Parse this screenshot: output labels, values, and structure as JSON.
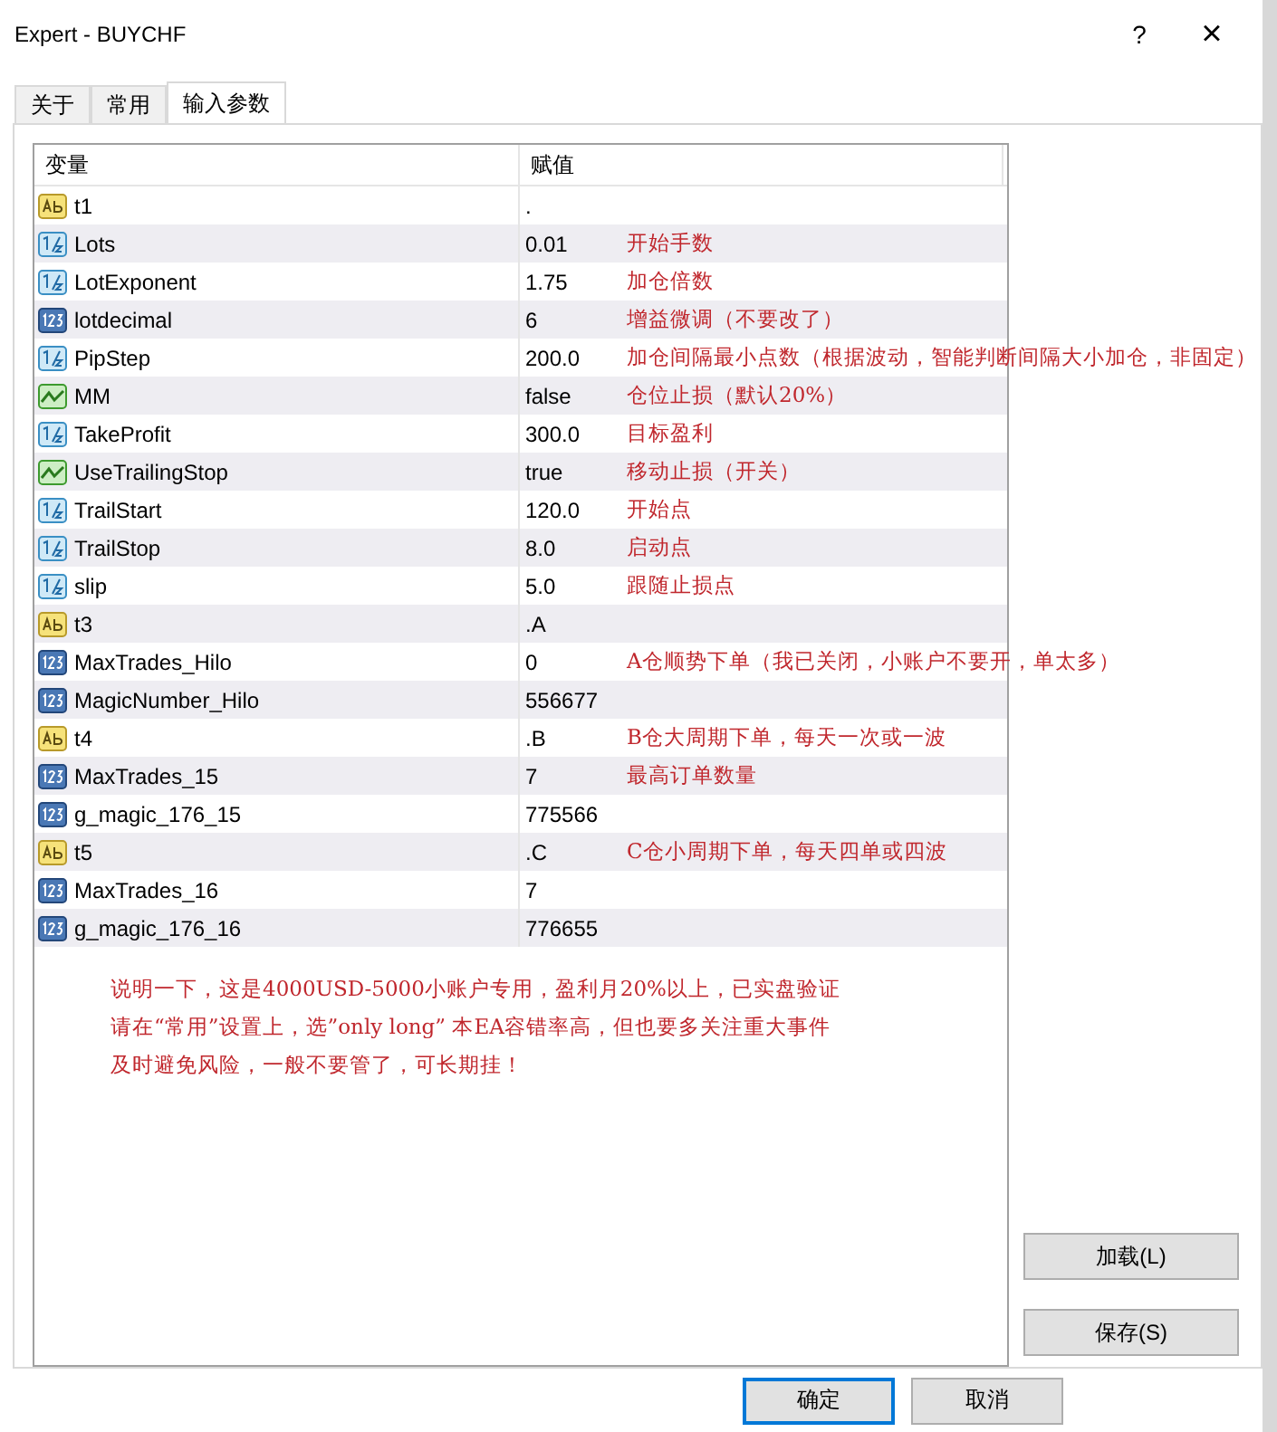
{
  "window": {
    "title": "Expert - BUYCHF",
    "help": "?",
    "close": "×"
  },
  "tabs": [
    {
      "label": "关于",
      "selected": false
    },
    {
      "label": "常用",
      "selected": false
    },
    {
      "label": "输入参数",
      "selected": true
    }
  ],
  "table": {
    "columns": [
      "变量",
      "赋值"
    ],
    "rows": [
      {
        "kind": "string",
        "name": "t1",
        "value": "."
      },
      {
        "kind": "double",
        "name": "Lots",
        "value": "0.01",
        "note": "开始手数"
      },
      {
        "kind": "double",
        "name": "LotExponent",
        "value": "1.75",
        "note": "加仓倍数"
      },
      {
        "kind": "int",
        "name": "lotdecimal",
        "value": "6",
        "note": "增益微调（不要改了）"
      },
      {
        "kind": "double",
        "name": "PipStep",
        "value": "200.0",
        "note": "加仓间隔最小点数（根据波动，智能判断间隔大小加仓，非固定）"
      },
      {
        "kind": "bool",
        "name": "MM",
        "value": "false",
        "note": "仓位止损（默认20%）"
      },
      {
        "kind": "double",
        "name": "TakeProfit",
        "value": "300.0",
        "note": "目标盈利"
      },
      {
        "kind": "bool",
        "name": "UseTrailingStop",
        "value": "true",
        "note": "移动止损（开关）"
      },
      {
        "kind": "double",
        "name": "TrailStart",
        "value": "120.0",
        "note": "开始点"
      },
      {
        "kind": "double",
        "name": "TrailStop",
        "value": "8.0",
        "note": "启动点"
      },
      {
        "kind": "double",
        "name": "slip",
        "value": "5.0",
        "note": "跟随止损点"
      },
      {
        "kind": "string",
        "name": "t3",
        "value": ".A"
      },
      {
        "kind": "int",
        "name": "MaxTrades_Hilo",
        "value": "0",
        "note": "A仓顺势下单（我已关闭，小账户不要开，单太多）"
      },
      {
        "kind": "int",
        "name": "MagicNumber_Hilo",
        "value": "556677"
      },
      {
        "kind": "string",
        "name": "t4",
        "value": ".B",
        "note": "B仓大周期下单，每天一次或一波"
      },
      {
        "kind": "int",
        "name": "MaxTrades_15",
        "value": "7",
        "note": "最高订单数量"
      },
      {
        "kind": "int",
        "name": "g_magic_176_15",
        "value": "775566"
      },
      {
        "kind": "string",
        "name": "t5",
        "value": ".C",
        "note": "C仓小周期下单，每天四单或四波"
      },
      {
        "kind": "int",
        "name": "MaxTrades_16",
        "value": "7"
      },
      {
        "kind": "int",
        "name": "g_magic_176_16",
        "value": "776655"
      }
    ]
  },
  "notes": [
    "说明一下，这是4000USD-5000小账户专用，盈利月20%以上，已实盘验证",
    "请在“常用”设置上，选”only long” 本EA容错率高，但也要多关注重大事件",
    "及时避免风险，一般不要管了，可长期挂！"
  ],
  "side_buttons": [
    "加载(L)",
    "保存(S)"
  ],
  "footer_buttons": [
    "确定",
    "取消"
  ]
}
